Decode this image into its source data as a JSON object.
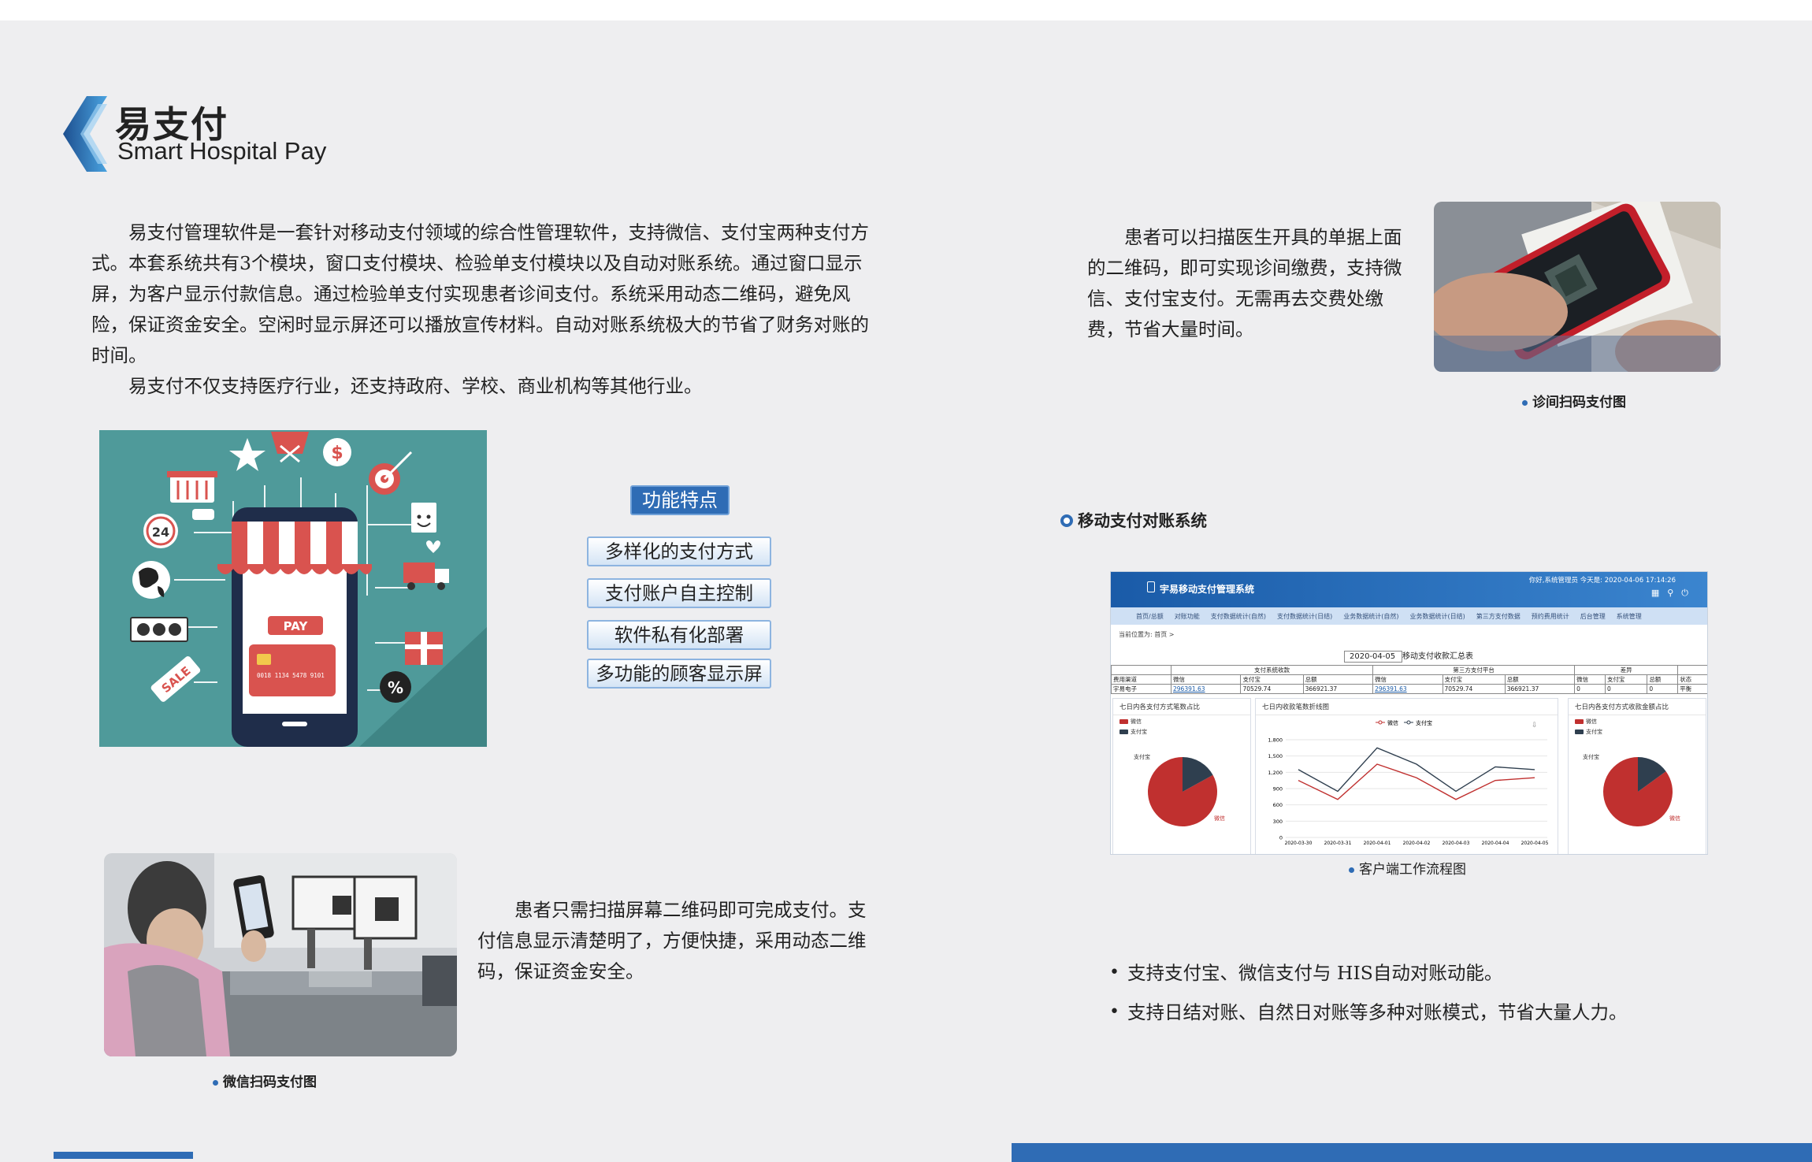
{
  "header": {
    "title_cn": "易支付",
    "title_en": "Smart Hospital Pay"
  },
  "intro": {
    "p1": "易支付管理软件是一套针对移动支付领域的综合性管理软件，支持微信、支付宝两种支付方式。本套系统共有3个模块，窗口支付模块、检验单支付模块以及自动对账系统。通过窗口显示屏，为客户显示付款信息。通过检验单支付实现患者诊间支付。系统采用动态二维码，避免风险，保证资金安全。空闲时显示屏还可以播放宣传材料。自动对账系统极大的节省了财务对账的时间。",
    "p2": "易支付不仅支持医疗行业，还支持政府、学校、商业机构等其他行业。"
  },
  "illustration": {
    "pay_label": "PAY",
    "sale_label": "SALE",
    "clock_label": "24",
    "card_number": "0018 1134 5478 9101",
    "percent_label": "%",
    "dollar_label": "$",
    "bill_label": "$ $"
  },
  "features": {
    "title": "功能特点",
    "items": [
      "多样化的支付方式",
      "支付账户自主控制",
      "软件私有化部署",
      "多功能的顾客显示屏"
    ]
  },
  "scan": {
    "desc": "患者可以扫描医生开具的单据上面的二维码，即可实现诊间缴费，支持微信、支付宝支付。无需再去交费处缴费，节省大量时间。",
    "caption": "诊间扫码支付图"
  },
  "reconcile": {
    "section_title": "移动支付对账系统",
    "system": {
      "name": "宇易移动支付管理系统",
      "user_info": "你好,系统管理员  今天是: 2020-04-06 17:14:26",
      "nav": [
        "首页/总额",
        "对账功能",
        "支付数据统计(自然)",
        "支付数据统计(日结)",
        "业务数据统计(自然)",
        "业务数据统计(日结)",
        "第三方支付数据",
        "预约费用统计",
        "后台管理",
        "系统管理"
      ],
      "crumb": "当前位置为:  首页 >",
      "date": "2020-04-05",
      "date_label": "移动支付收款汇总表",
      "table": {
        "group_headers": [
          "支付系统收款",
          "第三方支付平台",
          "差异"
        ],
        "col_headers": [
          "费用渠道",
          "微信",
          "支付宝",
          "总额",
          "微信",
          "支付宝",
          "总额",
          "微信",
          "支付宝",
          "总额",
          "状态"
        ],
        "row": [
          "宇易电子",
          "296391.63",
          "70529.74",
          "366921.37",
          "296391.63",
          "70529.74",
          "366921.37",
          "0",
          "0",
          "0",
          "平衡"
        ]
      },
      "panels": [
        {
          "title": "七日内各支付方式笔数占比",
          "legend": [
            "微信",
            "支付宝"
          ],
          "slice_labels": [
            "支付宝",
            "微信"
          ]
        },
        {
          "title": "七日内收款笔数折线图",
          "legend": [
            "微信",
            "支付宝"
          ]
        },
        {
          "title": "七日内各支付方式收款金额占比",
          "legend": [
            "微信",
            "支付宝"
          ],
          "slice_labels": [
            "支付宝",
            "微信"
          ]
        }
      ],
      "colors": {
        "wechat": "#c0302f",
        "alipay": "#2f3f4f"
      }
    },
    "caption": "客户端工作流程图",
    "bullets": [
      "支持支付宝、微信支付与 HIS自动对账动能。",
      "支持日结对账、自然日对账等多种对账模式，节省大量人力。"
    ]
  },
  "line_chart": {
    "yticks": [
      "1,800",
      "1,500",
      "1,200",
      "900",
      "600",
      "300",
      "0"
    ],
    "xticks": [
      "2020-03-30",
      "2020-03-31",
      "2020-04-01",
      "2020-04-02",
      "2020-04-03",
      "2020-04-04",
      "2020-04-05"
    ],
    "series": [
      {
        "name": "微信",
        "color": "#c0302f",
        "values": [
          1050,
          700,
          1350,
          1100,
          700,
          1050,
          1100
        ]
      },
      {
        "name": "支付宝",
        "color": "#2f3f4f",
        "values": [
          1250,
          850,
          1650,
          1350,
          850,
          1300,
          1250
        ]
      }
    ]
  },
  "pie_charts": [
    {
      "values": {
        "微信": 0.83,
        "支付宝": 0.17
      }
    },
    {
      "values": {
        "微信": 0.85,
        "支付宝": 0.15
      }
    }
  ],
  "wechat": {
    "desc": "患者只需扫描屏幕二维码即可完成支付。支付信息显示清楚明了，方便快捷，采用动态二维码，保证资金安全。",
    "caption": "微信扫码支付图"
  },
  "theme": {
    "accent": "#2f6cb5",
    "page_bg": "#eeeef0",
    "illus_bg": "#4f9a9a"
  }
}
